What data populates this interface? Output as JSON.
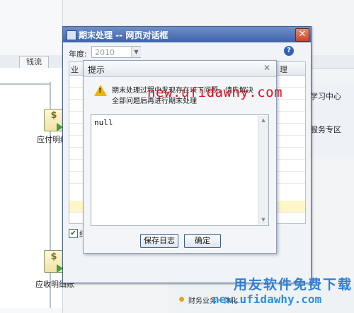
{
  "background": {
    "tab_label": "钱流",
    "nodes": [
      {
        "label": "应付明细",
        "icon": "document-money-icon"
      },
      {
        "label": "应收明细账",
        "icon": "document-money-icon"
      }
    ],
    "right_items": [
      "学习中心",
      "服务专区"
    ],
    "bottom_item": "财务业务一体化..."
  },
  "dialog": {
    "title": "期末处理 -- 网页对话框",
    "year_label": "年度:",
    "year_value": "2010",
    "grid_header_left": "业",
    "grid_header_right": "理",
    "check_label": "结"
  },
  "prompt": {
    "title": "提示",
    "message_line1": "期末处理过程中发现存在以下问题，请先解决",
    "message_line2": "全部问题后再进行期末处理",
    "log_text": "null",
    "save_log_label": "保存日志",
    "ok_label": "确定"
  },
  "watermarks": {
    "top": "new.ufidawhy.com",
    "bottom_cn": "用友软件免费下载",
    "bottom_url": "new.ufidawhy.com"
  },
  "colors": {
    "title_bar": "#3e64a8",
    "watermark_red": "#e0101e",
    "watermark_blue": "#2f7fd6",
    "highlight_row": "#fff6c8"
  }
}
